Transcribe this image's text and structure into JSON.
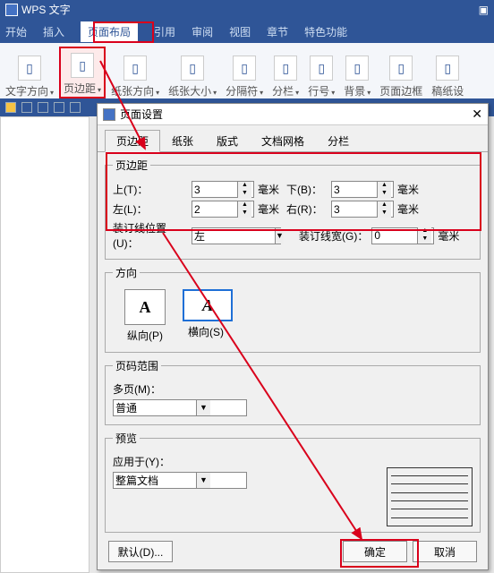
{
  "app": {
    "title": "WPS 文字"
  },
  "menus": [
    "开始",
    "插入",
    "页面布局",
    "引用",
    "审阅",
    "视图",
    "章节",
    "特色功能"
  ],
  "menus_active_index": 2,
  "ribbon": [
    {
      "label": "文字方向",
      "dd": true
    },
    {
      "label": "页边距",
      "dd": true,
      "sel": true
    },
    {
      "label": "纸张方向",
      "dd": true
    },
    {
      "label": "纸张大小",
      "dd": true
    },
    {
      "label": "分隔符",
      "dd": true
    },
    {
      "label": "分栏",
      "dd": true
    },
    {
      "label": "行号",
      "dd": true
    },
    {
      "label": "背景",
      "dd": true
    },
    {
      "label": "页面边框",
      "dd": false
    },
    {
      "label": "稿纸设",
      "dd": false
    }
  ],
  "dialog": {
    "title": "页面设置",
    "tabs": [
      "页边距",
      "纸张",
      "版式",
      "文档网格",
      "分栏"
    ],
    "tabs_active_index": 0,
    "margins": {
      "legend": "页边距",
      "top_label": "上(T)：",
      "top_value": "3",
      "top_unit": "毫米",
      "bottom_label": "下(B)：",
      "bottom_value": "3",
      "bottom_unit": "毫米",
      "left_label": "左(L)：",
      "left_value": "2",
      "left_unit": "毫米",
      "right_label": "右(R)：",
      "right_value": "3",
      "right_unit": "毫米",
      "gutter_pos_label": "装订线位置(U)：",
      "gutter_pos_value": "左",
      "gutter_w_label": "装订线宽(G)：",
      "gutter_w_value": "0",
      "gutter_w_unit": "毫米"
    },
    "orient": {
      "legend": "方向",
      "portrait": "纵向(P)",
      "landscape": "横向(S)",
      "sel": "landscape"
    },
    "range": {
      "legend": "页码范围",
      "multi_label": "多页(M)：",
      "multi_value": "普通"
    },
    "preview": {
      "legend": "预览",
      "apply_label": "应用于(Y)：",
      "apply_value": "整篇文档"
    },
    "buttons": {
      "default": "默认(D)...",
      "ok": "确定",
      "cancel": "取消"
    }
  }
}
